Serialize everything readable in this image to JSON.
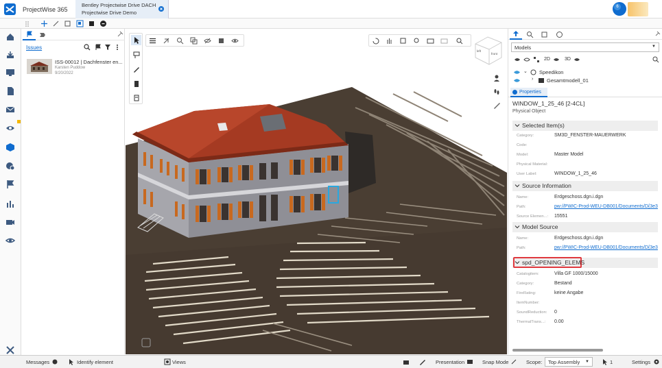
{
  "app": {
    "name": "ProjectWise 365",
    "tab_line1": "Bentley Projectwise Drive DACH",
    "tab_line2": "Projectwise Drive Demo",
    "notification_count": "6"
  },
  "issues": {
    "title": "Issues",
    "item": {
      "title": "ISS-00012 | Dachfenster en...",
      "author": "Karsten Puddow",
      "date": "9/20/2022"
    }
  },
  "viewport": {
    "navcube_left": "left",
    "navcube_front": "front"
  },
  "right": {
    "models_select": "Models",
    "tree": [
      {
        "label": "Speedikon"
      },
      {
        "label": "Gesamtmodell_01"
      }
    ],
    "properties_tab": "Properties",
    "element_title": "WINDOW_1_25_46 [2-4CL]",
    "element_type": "Physical Object",
    "selected_items": {
      "header": "Selected Item(s)",
      "rows": [
        {
          "label": "Category:",
          "value": "SM3D_FENSTER-MAUERWERK"
        },
        {
          "label": "Code:",
          "value": ""
        },
        {
          "label": "Model:",
          "value": "Master Model"
        },
        {
          "label": "Physical Material:",
          "value": ""
        },
        {
          "label": "User Label:",
          "value": "WINDOW_1_25_46"
        }
      ]
    },
    "source_info": {
      "header": "Source Information",
      "rows": [
        {
          "label": "Name:",
          "value": "Erdgeschoss.dgn.i.dgn"
        },
        {
          "label": "Path:",
          "value": "pw://PWIC-Prod-WEU-DB001/Documents/D{3e3"
        },
        {
          "label": "Source Elemen...:",
          "value": "15551"
        }
      ]
    },
    "model_source": {
      "header": "Model Source",
      "rows": [
        {
          "label": "Name:",
          "value": "Erdgeschoss.dgn.i.dgn"
        },
        {
          "label": "Path:",
          "value": "pw://PWIC-Prod-WEU-DB001/Documents/D{3e3"
        }
      ]
    },
    "spd": {
      "header": "spd_OPENING_ELEMS",
      "rows": [
        {
          "label": "Catalogitem:",
          "value": "Villa GF 1000/15000"
        },
        {
          "label": "Category:",
          "value": "Bestand"
        },
        {
          "label": "FireRating:",
          "value": "keine Angabe"
        },
        {
          "label": "ItemNumber:",
          "value": ""
        },
        {
          "label": "SoundReduction:",
          "value": "0"
        },
        {
          "label": "ThermalTrans...:",
          "value": "0.00"
        }
      ]
    }
  },
  "status": {
    "messages": "Messages",
    "identify": "Identify element",
    "views": "Views",
    "presentation": "Presentation",
    "snap_mode": "Snap Mode",
    "scope_label": "Scope:",
    "scope_value": "Top Assembly",
    "count": "1",
    "settings": "Settings"
  },
  "colors": {
    "accent": "#0f6ccf",
    "highlight_red": "#e0393e",
    "roof": "#a33a22",
    "wall": "#9a9aa0",
    "shutter": "#c8691f",
    "terrain": "#4a3e33"
  }
}
